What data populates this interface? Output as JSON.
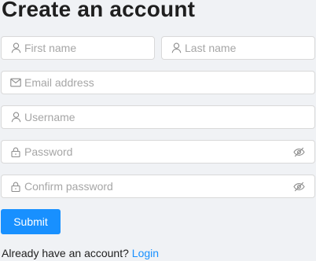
{
  "page": {
    "title": "Create an account"
  },
  "form": {
    "first_name": {
      "placeholder": "First name",
      "value": "",
      "icon": "user-icon"
    },
    "last_name": {
      "placeholder": "Last name",
      "value": "",
      "icon": "user-icon"
    },
    "email": {
      "placeholder": "Email address",
      "value": "",
      "icon": "mail-icon"
    },
    "username": {
      "placeholder": "Username",
      "value": "",
      "icon": "user-icon"
    },
    "password": {
      "placeholder": "Password",
      "value": "",
      "icon": "lock-icon",
      "toggle_icon": "eye-invisible-icon"
    },
    "confirm_password": {
      "placeholder": "Confirm password",
      "value": "",
      "icon": "lock-icon",
      "toggle_icon": "eye-invisible-icon"
    },
    "submit_label": "Submit"
  },
  "footer": {
    "prompt": "Already have an account?",
    "login_label": "Login"
  },
  "colors": {
    "primary": "#1890ff",
    "background": "#f0f2f5",
    "input_border": "#d9d9d9",
    "placeholder": "#a6a6a6"
  }
}
